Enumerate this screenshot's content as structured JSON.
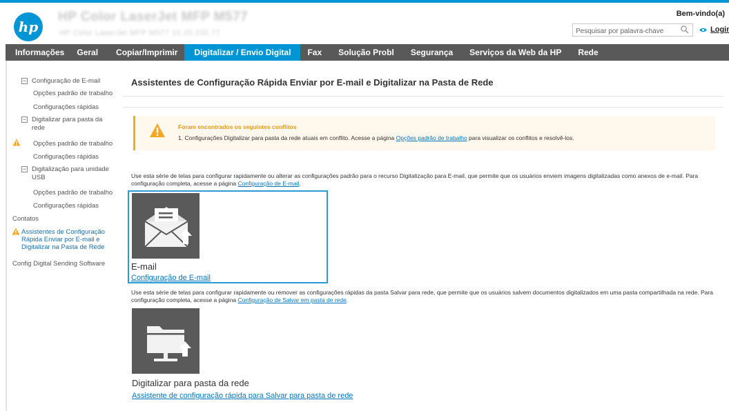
{
  "header": {
    "title": "HP Color LaserJet MFP M577",
    "subtitle": "HP Color LaserJet MFP M577   10.20.230.77",
    "welcome": "Bem-vindo(a)",
    "search_placeholder": "Pesquisar por palavra-chave",
    "login": "Login"
  },
  "nav": {
    "tabs": [
      {
        "label": "Informações"
      },
      {
        "label": "Geral"
      },
      {
        "label": "Copiar/Imprimir"
      },
      {
        "label": "Digitalizar / Envio Digital",
        "active": true
      },
      {
        "label": "Fax"
      },
      {
        "label": "Solução Probl"
      },
      {
        "label": "Segurança"
      },
      {
        "label": "Serviços da Web da HP"
      },
      {
        "label": "Rede"
      }
    ]
  },
  "sidebar": {
    "items": [
      {
        "label": "Configuração de E-mail"
      },
      {
        "label": "Opções padrão de trabalho"
      },
      {
        "label": "Configurações rápidas"
      },
      {
        "label": "Digitalizar para pasta da rede"
      },
      {
        "label": "Opções padrão de trabalho",
        "warning": true
      },
      {
        "label": "Configurações rápidas"
      },
      {
        "label": "Digitalização para unidade USB"
      },
      {
        "label": "Opções padrão de trabalho"
      },
      {
        "label": "Configurações rápidas"
      },
      {
        "label": "Contatos"
      },
      {
        "label": "Assistentes de Configuração Rápida Enviar por E-mail e Digitalizar na Pasta de Rede",
        "warning": true,
        "active": true
      },
      {
        "label": "Config Digital Sending Software"
      }
    ]
  },
  "main": {
    "title": "Assistentes de Configuração Rápida Enviar por E-mail e Digitalizar na Pasta de Rede",
    "alert": {
      "title": "Foram encontrados os seguintes conflitos",
      "msg_prefix": "1.  Configurações Digitalizar para pasta da rede atuais em conflito. Acesse a página ",
      "msg_link": "Opções padrão de trabalho",
      "msg_suffix": " para visualizar os conflitos e resolvê-los."
    },
    "email": {
      "desc": "Use esta série de telas para configurar rapidamente ou alterar as configurações padrão para o recurso Digitalização para E-mail, que permite que os usuários enviem imagens digitalizadas como anexos de e-mail. Para configuração completa, acesse a página ",
      "desc_link": "Configuração de E-mail",
      "desc_end": ".",
      "tile_title": "E-mail",
      "tile_link": "Configuração de E-mail"
    },
    "folder": {
      "desc": "Use esta série de telas para configurar rapidamente ou remover as configurações rápidas da pasta Salvar para rede, que permite que os usuários salvem documentos digitalizados em uma pasta compartilhada na rede. Para configuração completa, acesse a página ",
      "desc_link": "Configuração de Salvar em pasta de rede",
      "desc_end": ".",
      "tile_title": "Digitalizar para pasta da rede",
      "tile_link": "Assistente de configuração rápida para Salvar para pasta de rede"
    }
  }
}
